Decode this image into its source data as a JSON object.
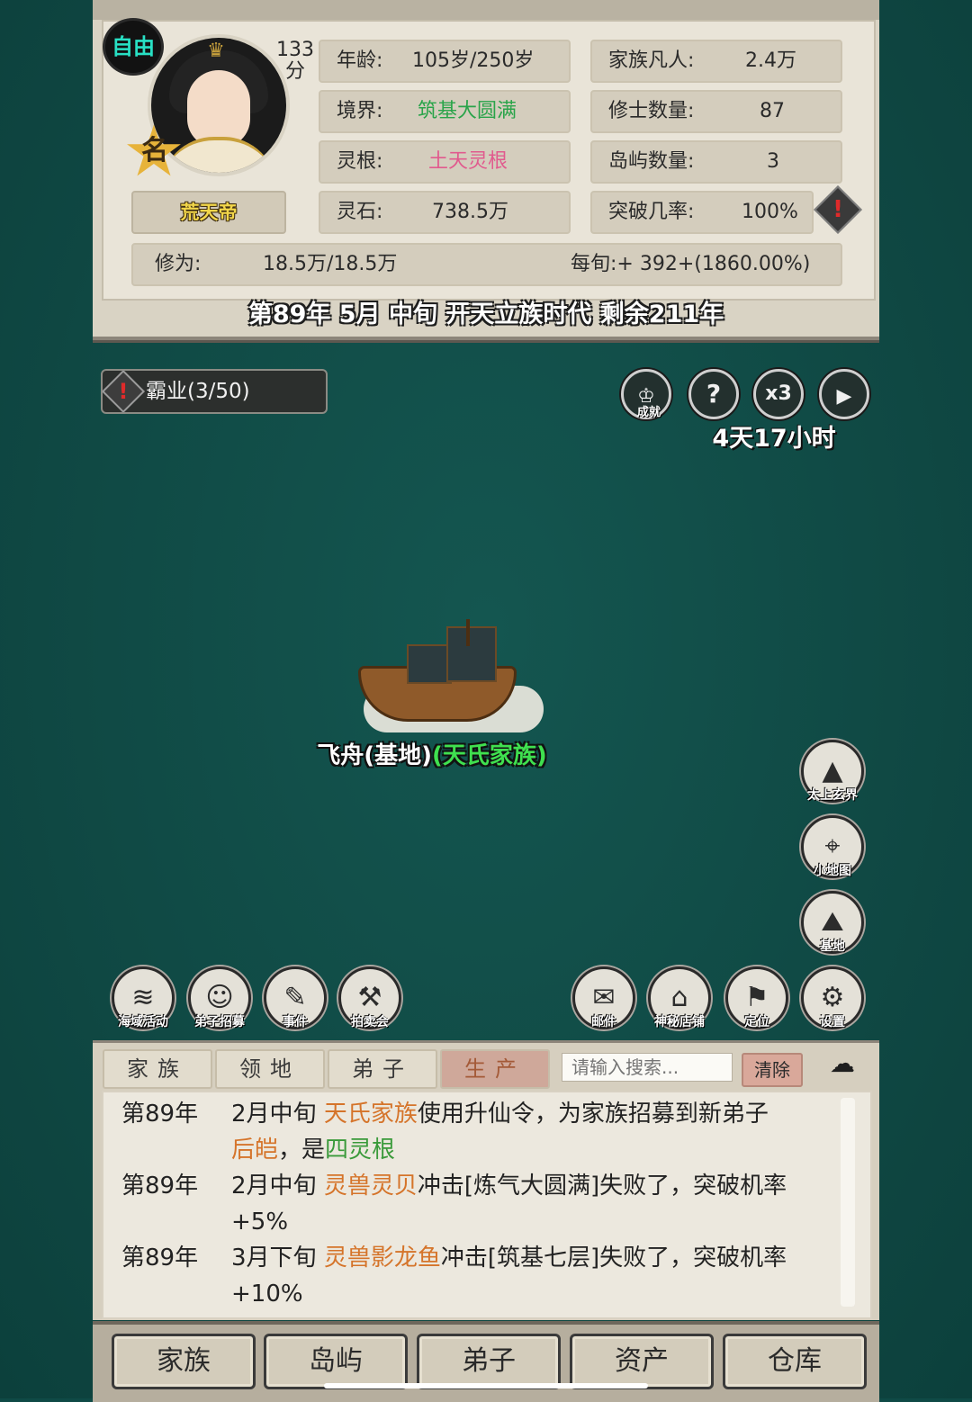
{
  "status_badge": "自由",
  "score": {
    "value": "133",
    "unit": "分"
  },
  "name_star": "名",
  "player_title": "荒天帝",
  "stats_left": [
    {
      "label": "年龄:",
      "value": "105岁/250岁"
    },
    {
      "label": "境界:",
      "value": "筑基大圆满"
    },
    {
      "label": "灵根:",
      "value": "土天灵根"
    },
    {
      "label": "灵石:",
      "value": "738.5万"
    }
  ],
  "stats_right": [
    {
      "label": "家族凡人:",
      "value": "2.4万"
    },
    {
      "label": "修士数量:",
      "value": "87"
    },
    {
      "label": "岛屿数量:",
      "value": "3"
    },
    {
      "label": "突破几率:",
      "value": "100%"
    }
  ],
  "cultivation": {
    "label": "修为:",
    "value": "18.5万/18.5万",
    "per_period": "每旬:+ 392+(1860.00%)"
  },
  "date_line": "第89年 5月 中旬  开天立族时代 剩余211年",
  "mission": "霸业(3/50)",
  "tools": {
    "achievement_caption": "成就",
    "help_symbol": "?",
    "speed": "x3",
    "timer": "4天17小时"
  },
  "airship": {
    "name": "飞舟(基地)",
    "owner": "(天氏家族)"
  },
  "side_buttons": [
    "太上玄界",
    "小地图",
    "基地"
  ],
  "bottom_left_buttons": [
    "海域活动",
    "弟子招募",
    "事件",
    "拍卖会"
  ],
  "bottom_right_buttons": [
    "邮件",
    "神秘店铺",
    "定位",
    "设置"
  ],
  "log_tabs": [
    "家族",
    "领地",
    "弟子",
    "生产"
  ],
  "search": {
    "placeholder": "请输入搜索...",
    "clear": "清除"
  },
  "log": [
    {
      "year": "第89年",
      "period": "2月中旬 ",
      "a": "天氏家族",
      "b": "使用升仙令，为家族招募到新弟子",
      "c": "后皑",
      "d": "，是",
      "e": "四灵根"
    },
    {
      "year": "第89年",
      "period": "2月中旬 ",
      "a": "灵兽灵贝",
      "b": "冲击[炼气大圆满]失败了，突破机率",
      "c": "+5%"
    },
    {
      "year": "第89年",
      "period": "3月下旬 ",
      "a": "灵兽影龙鱼",
      "b": "冲击[筑基七层]失败了，突破机率",
      "c": "+10%"
    }
  ],
  "bottom_nav": [
    "家族",
    "岛屿",
    "弟子",
    "资产",
    "仓库"
  ]
}
